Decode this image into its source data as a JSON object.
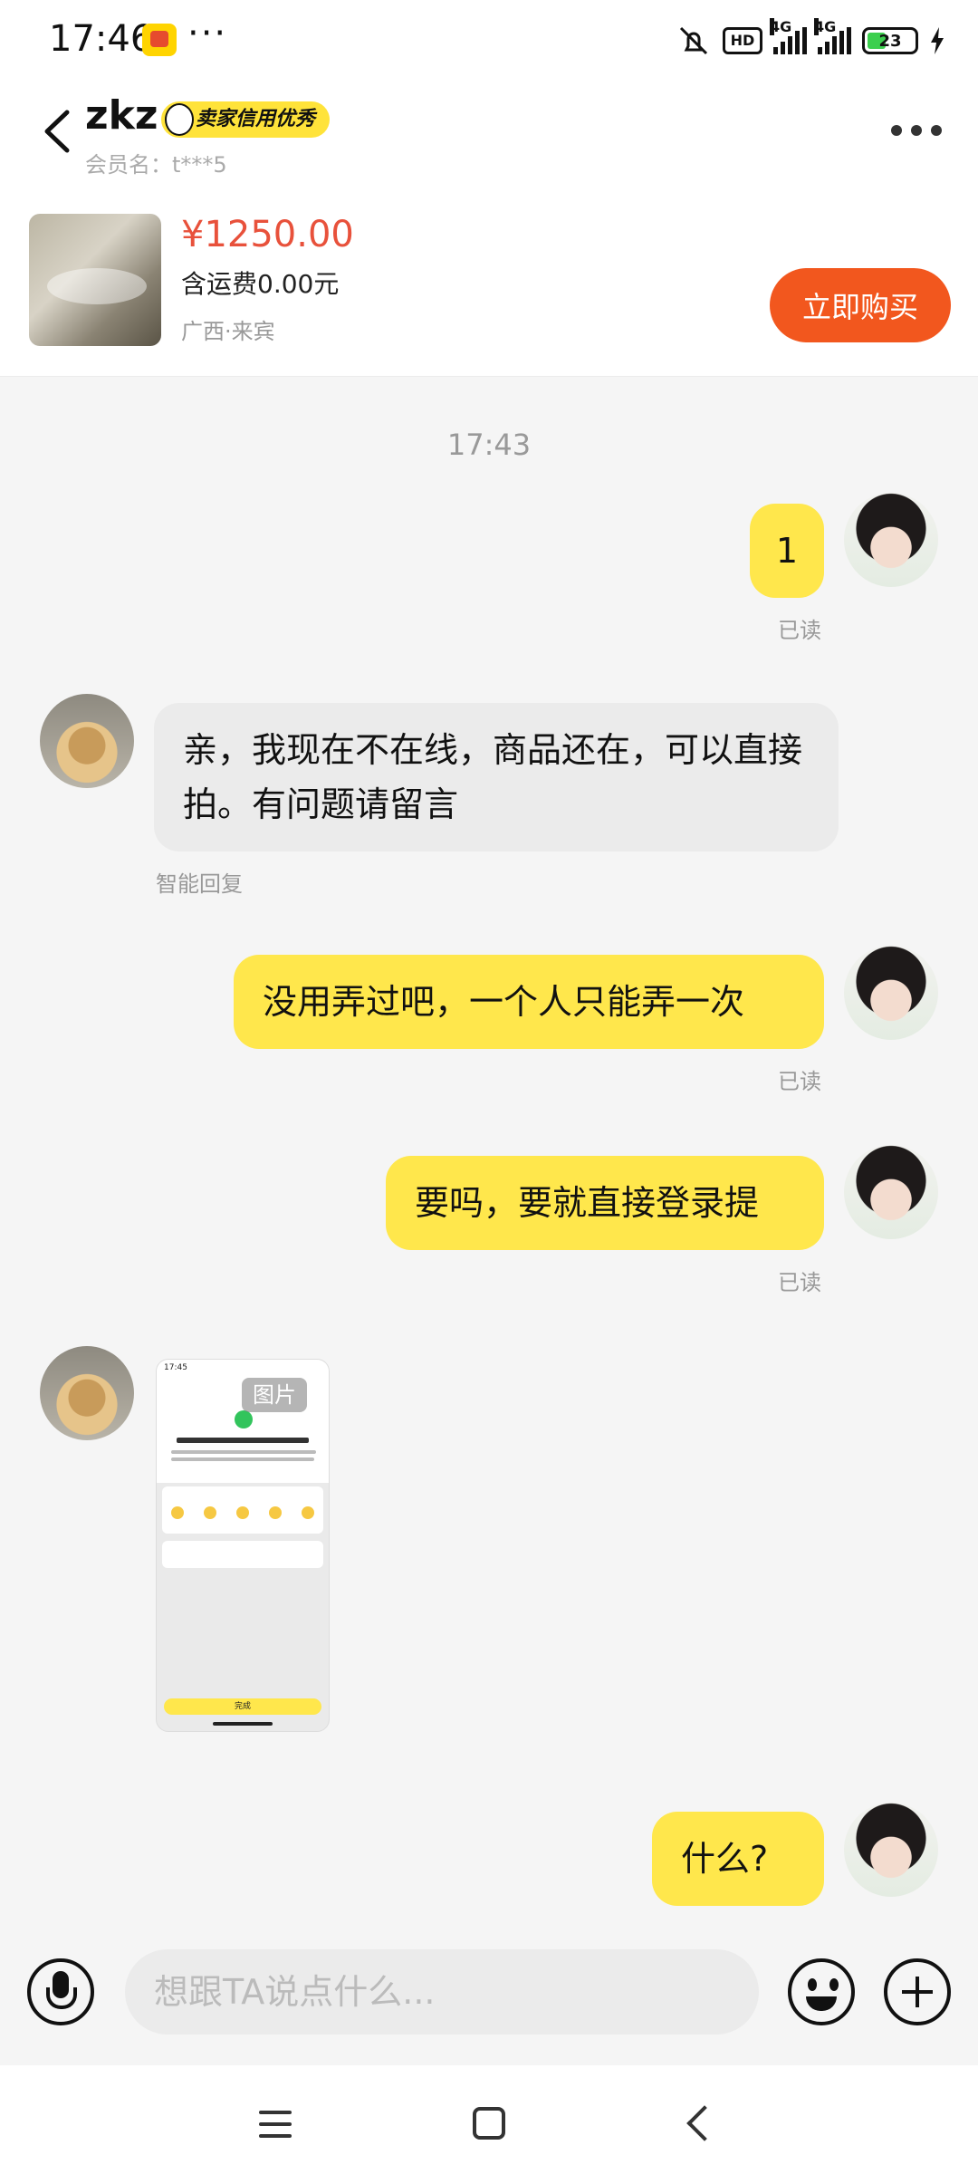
{
  "status_bar": {
    "time": "17:46",
    "dots": "···",
    "hd": "HD",
    "net1": "4G",
    "net2": "4G",
    "battery": "23"
  },
  "header": {
    "seller_name": "zkz",
    "credit_badge": "卖家信用优秀",
    "member": "会员名：t***5"
  },
  "product": {
    "price": "¥1250.00",
    "shipping": "含运费0.00元",
    "location": "广西·来宾",
    "buy_label": "立即购买"
  },
  "chat": {
    "timestamp": "17:43",
    "read_label": "已读",
    "smart_reply_label": "智能回复",
    "messages": [
      {
        "from": "me",
        "text": "1"
      },
      {
        "from": "them",
        "text": "亲，我现在不在线，商品还在，可以直接拍。有问题请留言"
      },
      {
        "from": "me",
        "text": "没用弄过吧，一个人只能弄一次"
      },
      {
        "from": "me",
        "text": "要吗，要就直接登录提"
      },
      {
        "from": "them",
        "type": "image",
        "tag": "图片"
      },
      {
        "from": "me",
        "text": "什么?"
      }
    ],
    "image": {
      "time": "17:45",
      "title": "感谢你的举报，我们将尽快处理",
      "question": "你对本次举报体验满意吗?",
      "survey": "闲鱼小法庭邀你参与评审",
      "done": "完成"
    }
  },
  "input": {
    "placeholder": "想跟TA说点什么..."
  },
  "icons": {
    "back": "chevron-left-icon",
    "more": "more-horizontal-icon",
    "mic": "microphone-icon",
    "emoji": "emoji-icon",
    "plus": "plus-icon"
  },
  "colors": {
    "accent_yellow": "#ffe74c",
    "price_red": "#e8513b",
    "buy_orange": "#f2571e"
  }
}
